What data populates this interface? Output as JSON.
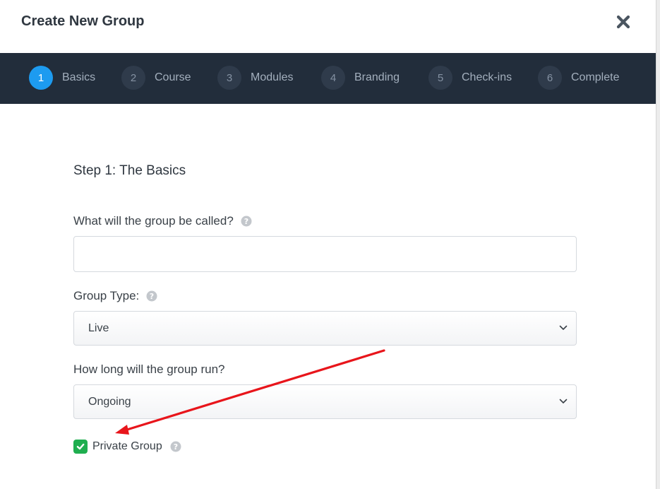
{
  "modal": {
    "title": "Create New Group",
    "close_icon": "close-x-icon"
  },
  "steps": [
    {
      "number": "1",
      "label": "Basics",
      "active": true
    },
    {
      "number": "2",
      "label": "Course",
      "active": false
    },
    {
      "number": "3",
      "label": "Modules",
      "active": false
    },
    {
      "number": "4",
      "label": "Branding",
      "active": false
    },
    {
      "number": "5",
      "label": "Check-ins",
      "active": false
    },
    {
      "number": "6",
      "label": "Complete",
      "active": false
    }
  ],
  "form": {
    "step_title": "Step 1: The Basics",
    "group_name": {
      "label": "What will the group be called?",
      "value": "",
      "help_icon": "question-circle-icon"
    },
    "group_type": {
      "label": "Group Type:",
      "value": "Live",
      "help_icon": "question-circle-icon"
    },
    "duration": {
      "label": "How long will the group run?",
      "value": "Ongoing"
    },
    "private_group": {
      "label": "Private Group",
      "checked": true,
      "help_icon": "question-circle-icon"
    }
  },
  "colors": {
    "steps_bar": "#222d3b",
    "active_step": "#1d9bf0",
    "checkbox": "#1fae4f",
    "annotation_arrow": "#e8151b"
  }
}
